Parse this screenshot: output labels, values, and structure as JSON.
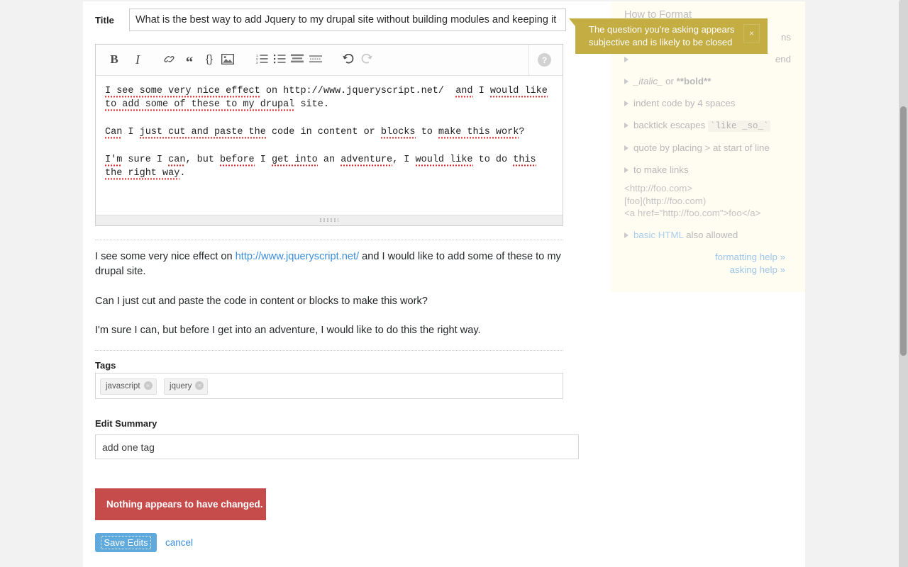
{
  "form": {
    "title_label": "Title",
    "title_value": "What is the best way to add Jquery to my drupal site without building modules and keeping it cu",
    "tags_label": "Tags",
    "tags": [
      {
        "name": "javascript",
        "remove_icon": "×"
      },
      {
        "name": "jquery",
        "remove_icon": "×"
      }
    ],
    "edit_summary_label": "Edit Summary",
    "edit_summary_value": "add one tag"
  },
  "editor": {
    "toolbar": [
      {
        "name": "bold-button",
        "label": "B"
      },
      {
        "name": "italic-button",
        "label": "I"
      },
      {
        "name": "link-button",
        "label": "link-icon"
      },
      {
        "name": "quote-button",
        "label": "“"
      },
      {
        "name": "code-button",
        "label": "{}"
      },
      {
        "name": "image-button",
        "label": "image-icon"
      },
      {
        "name": "numbered-list-button",
        "label": "ordered-list-icon"
      },
      {
        "name": "bullet-list-button",
        "label": "unordered-list-icon"
      },
      {
        "name": "heading-button",
        "label": "heading-icon"
      },
      {
        "name": "hr-button",
        "label": "horizontal-rule-icon"
      },
      {
        "name": "undo-button",
        "label": "undo-icon"
      },
      {
        "name": "redo-button",
        "label": "redo-icon"
      },
      {
        "name": "help-button",
        "label": "?"
      }
    ],
    "body_line1a": "I see some very nice effect",
    "body_line1b": " on http://www.jqueryscript.net/  ",
    "body_line1c": "and",
    "body_line1d": " I ",
    "body_line1e": "would like",
    "body_line2a": "to add some of these to my drupal",
    "body_line2b": " site.",
    "body_line3a": "Can",
    "body_line3b": " I ",
    "body_line3c": "just cut and paste the",
    "body_line3d": " code in content or ",
    "body_line3e": "blocks",
    "body_line3f": " to ",
    "body_line3g": "make this work",
    "body_line3h": "?",
    "body_line4a": "I'm",
    "body_line4b": " sure I ",
    "body_line4c": "can",
    "body_line4d": ", but ",
    "body_line4e": "before",
    "body_line4f": " I ",
    "body_line4g": "get into",
    "body_line4h": " an ",
    "body_line4i": "adventure",
    "body_line4j": ", I ",
    "body_line4k": "would like",
    "body_line4l": " to do ",
    "body_line4m": "this",
    "body_line5a": "the right way",
    "body_line5b": "."
  },
  "preview": {
    "p1_before": "I see some very nice effect on ",
    "p1_link": "http://www.jqueryscript.net/",
    "p1_after": " and I would like to add some of these to my drupal site.",
    "p2": "Can I just cut and paste the code in content or blocks to make this work?",
    "p3": "I'm sure I can, but before I get into an adventure, I would like to do this the right way."
  },
  "status": {
    "error_message": "Nothing appears to have changed."
  },
  "actions": {
    "save_label": "Save Edits",
    "cancel_label": "cancel"
  },
  "popup": {
    "message": "The question you're asking appears subjective and is likely to be closed",
    "close_label": "×"
  },
  "sidebar": {
    "heading": "How to Format",
    "items": [
      {
        "pre": "",
        "code": "",
        "post": "ns",
        "partial": true
      },
      {
        "pre": "",
        "code": "",
        "post": "end",
        "partial": true
      },
      {
        "pre": "",
        "code": "_italic_",
        "mid": " or ",
        "code2": "**bold**",
        "post": ""
      },
      {
        "pre": "indent code by 4 spaces",
        "code": "",
        "post": ""
      },
      {
        "pre": "backtick escapes ",
        "code": "`like _so_`",
        "post": ""
      },
      {
        "pre": "quote by placing > at start of line",
        "code": "",
        "post": ""
      },
      {
        "pre": "to make links",
        "code": "",
        "post": ""
      }
    ],
    "link_examples": [
      "<http://foo.com>",
      "[foo](http://foo.com)",
      "<a href=\"http://foo.com\">foo</a>"
    ],
    "html_item_link": "basic HTML",
    "html_item_rest": " also allowed",
    "footer_links": [
      "formatting help »",
      "asking help »"
    ]
  },
  "colors": {
    "page_bg": "#f2f2f2",
    "sheet_bg": "#ffffff",
    "sidebar_bg": "#fffdf2",
    "popup_bg": "#c4ad43",
    "error_bg": "#c64b4b",
    "save_btn": "#5fa9dd",
    "link": "#3b8ede"
  }
}
